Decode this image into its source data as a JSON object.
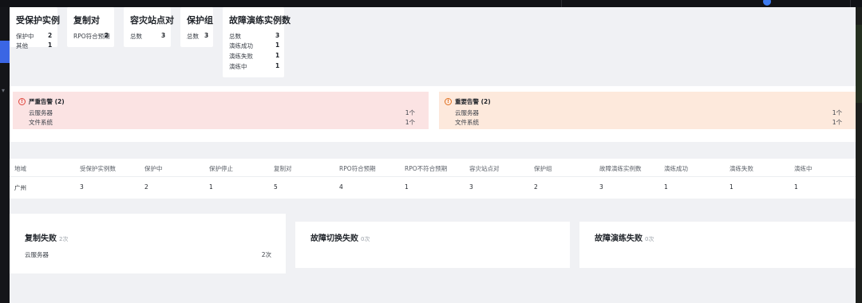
{
  "summary_cards": {
    "protected": {
      "title": "受保护实例",
      "rows": [
        {
          "label": "保护中",
          "value": "2"
        },
        {
          "label": "其他",
          "value": "1"
        }
      ]
    },
    "replication": {
      "title": "复制对",
      "rows": [
        {
          "label": "RPO符合预期",
          "value": "2"
        }
      ]
    },
    "sites": {
      "title": "容灾站点对",
      "rows": [
        {
          "label": "总数",
          "value": "3"
        }
      ]
    },
    "groups": {
      "title": "保护组",
      "rows": [
        {
          "label": "总数",
          "value": "3"
        }
      ]
    },
    "drills": {
      "title": "故障演练实例数",
      "rows": [
        {
          "label": "总数",
          "value": "3"
        },
        {
          "label": "演练成功",
          "value": "1"
        },
        {
          "label": "演练失败",
          "value": "1"
        },
        {
          "label": "演练中",
          "value": "1"
        }
      ]
    }
  },
  "alerts": {
    "critical": {
      "title": "严重告警 (2)",
      "items": [
        {
          "label": "云服务器",
          "count": "1个"
        },
        {
          "label": "文件系统",
          "count": "1个"
        }
      ]
    },
    "major": {
      "title": "重要告警 (2)",
      "items": [
        {
          "label": "云服务器",
          "count": "1个"
        },
        {
          "label": "文件系统",
          "count": "1个"
        }
      ]
    }
  },
  "region_table": {
    "headers": [
      "地域",
      "受保护实例数",
      "保护中",
      "保护停止",
      "复制对",
      "RPO符合预期",
      "RPO不符合预期",
      "容灾站点对",
      "保护组",
      "故障演练实例数",
      "演练成功",
      "演练失败",
      "演练中"
    ],
    "rows": [
      [
        "广州",
        "3",
        "2",
        "1",
        "5",
        "4",
        "1",
        "3",
        "2",
        "3",
        "1",
        "1",
        "1"
      ]
    ]
  },
  "failures": {
    "replication": {
      "title": "复制失败",
      "count": "2次",
      "items": [
        {
          "label": "云服务器",
          "value": "2次"
        }
      ]
    },
    "switchover": {
      "title": "故障切换失败",
      "count": "0次"
    },
    "drill": {
      "title": "故障演练失败",
      "count": "0次"
    }
  },
  "colors": {
    "critical_bg": "#fbe3e3",
    "major_bg": "#fde9dc",
    "accent": "#3b66e4"
  }
}
